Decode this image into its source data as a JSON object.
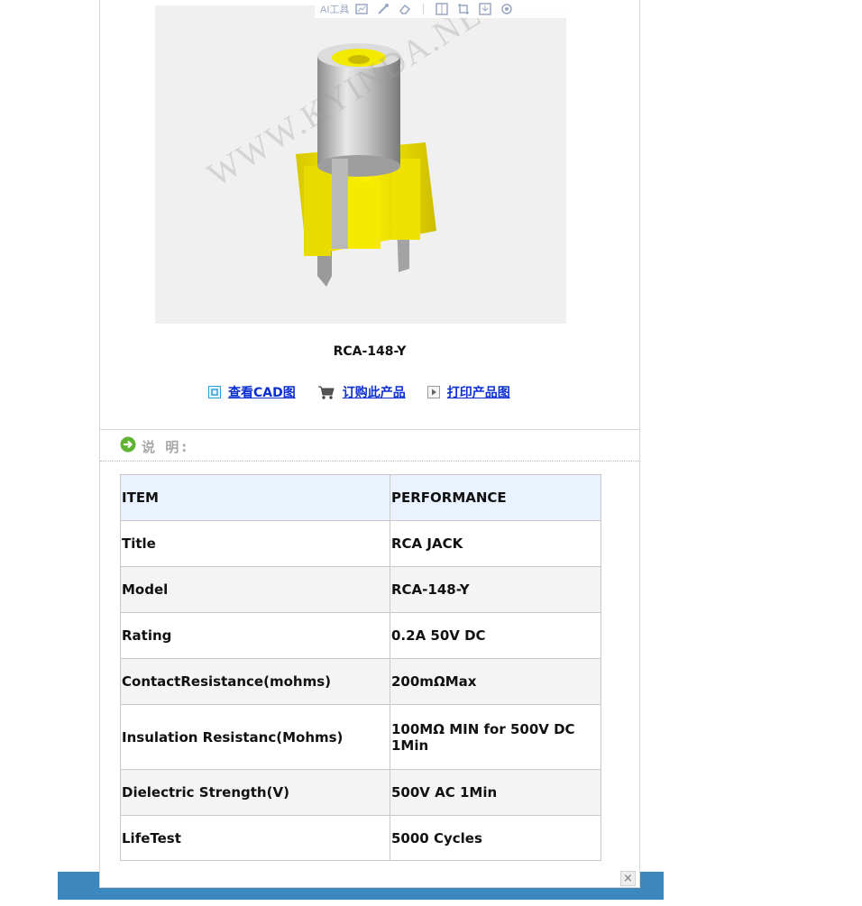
{
  "toolbar": {
    "ai_label": "AI工具"
  },
  "product": {
    "photo_watermark": "WWW.KYINDA.NET",
    "model_caption": "RCA-148-Y"
  },
  "actions": [
    {
      "label": "查看CAD图",
      "icon": "cad-icon"
    },
    {
      "label": "订购此产品",
      "icon": "cart-icon"
    },
    {
      "label": "打印产品图",
      "icon": "play-arrow-icon"
    }
  ],
  "section": {
    "title": "说 明:"
  },
  "spec_table": {
    "headers": [
      "ITEM",
      "PERFORMANCE"
    ],
    "rows": [
      [
        "Title",
        "RCA JACK"
      ],
      [
        "Model",
        "RCA-148-Y"
      ],
      [
        "Rating",
        "0.2A 50V DC"
      ],
      [
        "ContactResistance(mohms)",
        "200mΩMax"
      ],
      [
        "Insulation Resistanc(Mohms)",
        "100MΩ MIN for 500V DC 1Min"
      ],
      [
        "Dielectric Strength(V)",
        "500V AC 1Min"
      ],
      [
        "LifeTest",
        "5000 Cycles"
      ]
    ]
  },
  "colors": {
    "link": "#0a2ed2",
    "bottom_bar": "#3d87bf",
    "header_row": "#eaf2ff",
    "connector": "#f2e600"
  },
  "close_label": "×"
}
